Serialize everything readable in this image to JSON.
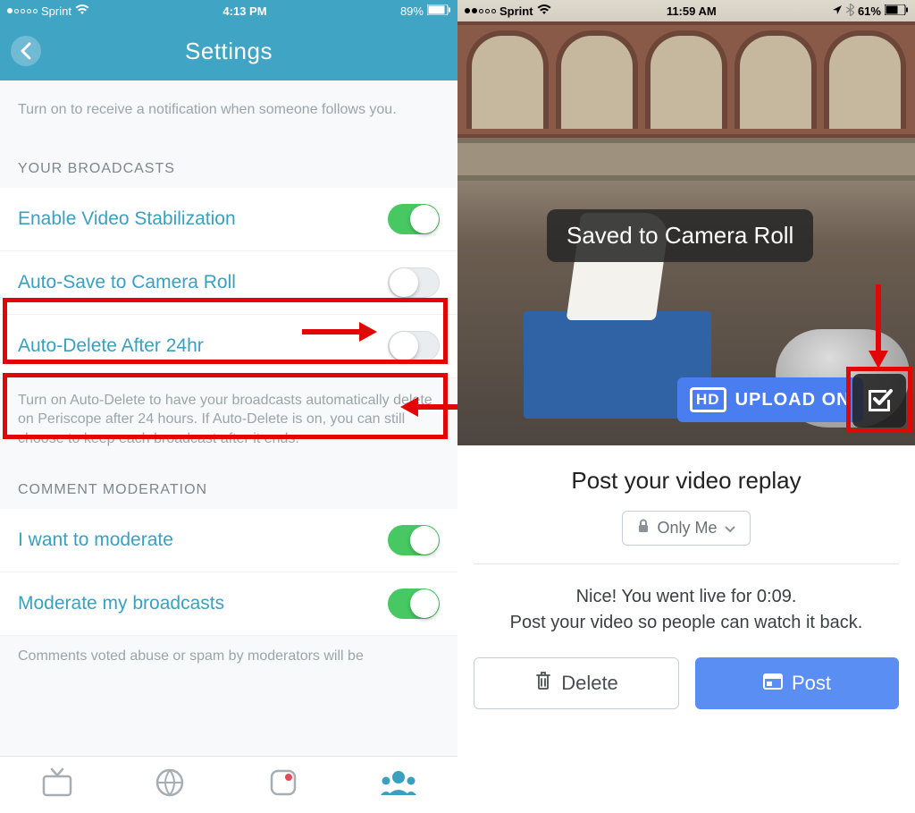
{
  "left": {
    "status": {
      "carrier": "Sprint",
      "time": "4:13 PM",
      "battery": "89%"
    },
    "nav_title": "Settings",
    "help_follow": "Turn on to receive a notification when someone follows you.",
    "section_broadcasts": "YOUR BROADCASTS",
    "rows": {
      "stabilization": "Enable Video Stabilization",
      "autosave": "Auto-Save to Camera Roll",
      "autodelete": "Auto-Delete After 24hr"
    },
    "help_autodelete": "Turn on Auto-Delete to have your broadcasts automatically delete on Periscope after 24 hours. If Auto-Delete is on, you can still choose to keep each broadcast after it ends.",
    "section_moderation": "COMMENT MODERATION",
    "rows2": {
      "want_moderate": "I want to moderate",
      "moderate_broadcasts": "Moderate my broadcasts"
    },
    "help_moderation": "Comments voted abuse or spam by moderators will be"
  },
  "right": {
    "status": {
      "carrier": "Sprint",
      "time": "11:59 AM",
      "battery": "61%"
    },
    "toast": "Saved to Camera Roll",
    "hd_label": "HD",
    "upload_label": "UPLOAD ON",
    "post_title": "Post your video replay",
    "privacy": "Only Me",
    "msg_line1": "Nice! You went live for 0:09.",
    "msg_line2": "Post your video so people can watch it back.",
    "delete_label": "Delete",
    "post_label": "Post"
  }
}
